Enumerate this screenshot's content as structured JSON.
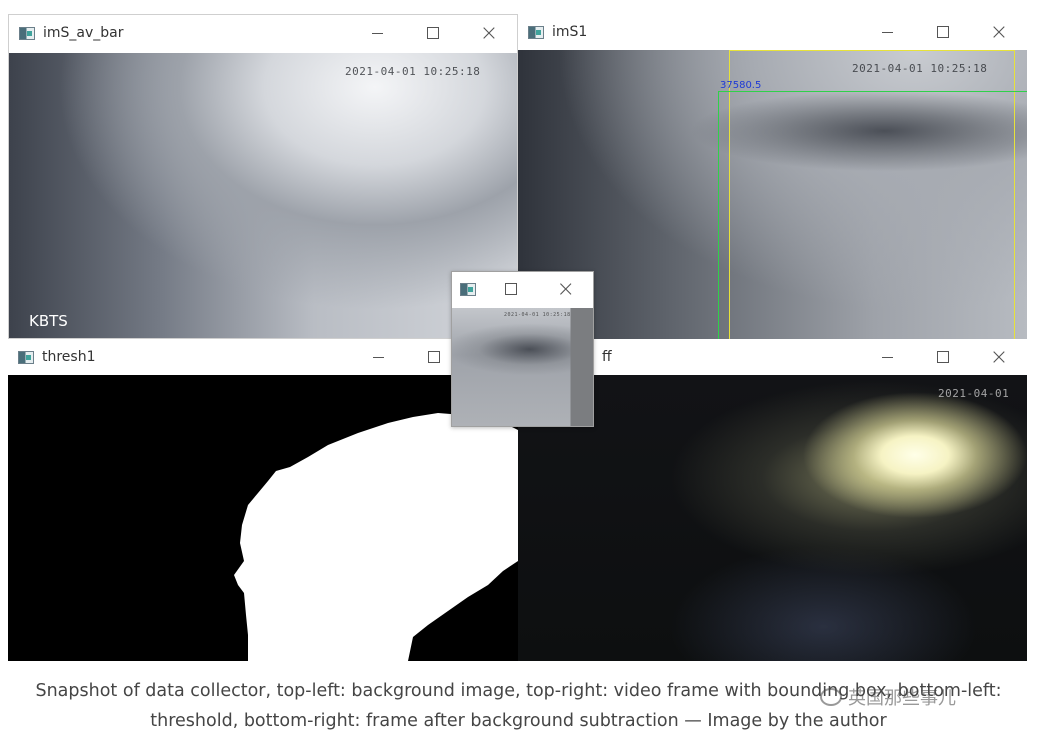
{
  "windows": {
    "avbar": {
      "title": "imS_av_bar",
      "timestamp": "2021-04-01 10:25:18",
      "label": "KBTS"
    },
    "ims1": {
      "title": "imS1",
      "timestamp": "2021-04-01 10:25:18",
      "bbox_label": "37580.5",
      "bbox_colors": {
        "outer": "#e7e23a",
        "inner": "#2fd14a"
      }
    },
    "thresh": {
      "title": "thresh1"
    },
    "diff": {
      "title": "ff",
      "timestamp": "2021-04-01"
    },
    "small": {
      "title": ""
    }
  },
  "caption": {
    "line1": "Snapshot of data collector, top-left: background image, top-right: video frame with bounding box, bottom-left:",
    "line2": "threshold, bottom-right: frame after background subtraction — Image by the author"
  },
  "watermark": {
    "text": "英国那些事儿"
  }
}
